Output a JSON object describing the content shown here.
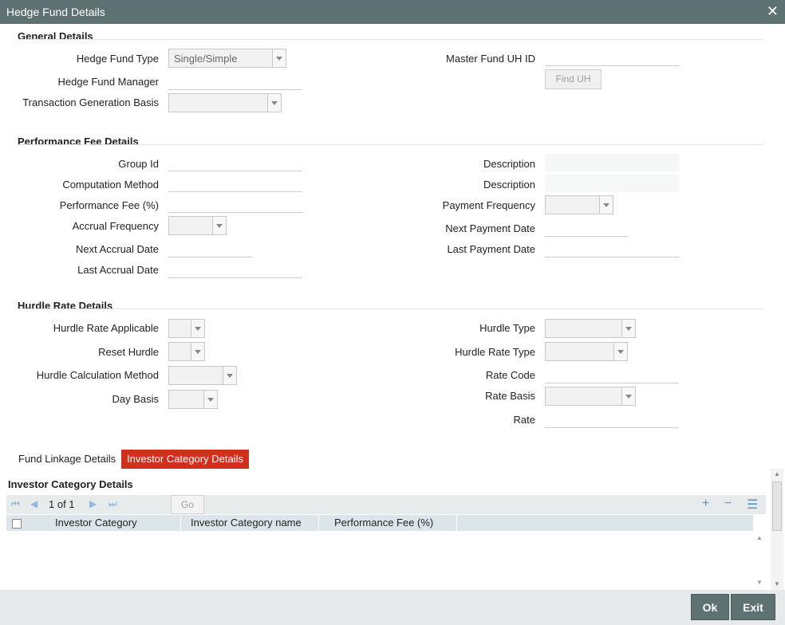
{
  "window": {
    "title": "Hedge Fund Details",
    "close_glyph": "✕"
  },
  "general": {
    "heading": "General Details",
    "hedge_fund_type_label": "Hedge Fund Type",
    "hedge_fund_type_value": "Single/Simple",
    "hedge_fund_manager_label": "Hedge Fund Manager",
    "transaction_generation_basis_label": "Transaction Generation Basis",
    "master_fund_uh_id_label": "Master Fund UH ID",
    "find_uh_button": "Find UH"
  },
  "performance": {
    "heading": "Performance Fee Details",
    "group_id_label": "Group Id",
    "computation_method_label": "Computation Method",
    "performance_fee_label": "Performance Fee (%)",
    "accrual_frequency_label": "Accrual Frequency",
    "next_accrual_date_label": "Next Accrual Date",
    "last_accrual_date_label": "Last Accrual Date",
    "description_label_1": "Description",
    "description_label_2": "Description",
    "payment_frequency_label": "Payment Frequency",
    "next_payment_date_label": "Next Payment Date",
    "last_payment_date_label": "Last Payment Date"
  },
  "hurdle": {
    "heading": "Hurdle Rate Details",
    "hurdle_rate_applicable_label": "Hurdle Rate Applicable",
    "reset_hurdle_label": "Reset Hurdle",
    "hurdle_calculation_method_label": "Hurdle Calculation Method",
    "day_basis_label": "Day Basis",
    "hurdle_type_label": "Hurdle Type",
    "hurdle_rate_type_label": "Hurdle Rate Type",
    "rate_code_label": "Rate Code",
    "rate_basis_label": "Rate Basis",
    "rate_label": "Rate"
  },
  "tabs": [
    {
      "label": "Fund Linkage Details",
      "active": false
    },
    {
      "label": "Investor Category Details",
      "active": true
    }
  ],
  "grid": {
    "title": "Investor Category Details",
    "page_info": "1 of 1",
    "go_label": "Go",
    "columns": [
      "Investor Category",
      "Investor Category name",
      "Performance Fee (%)"
    ],
    "rows": []
  },
  "footer": {
    "ok_label": "Ok",
    "exit_label": "Exit"
  }
}
